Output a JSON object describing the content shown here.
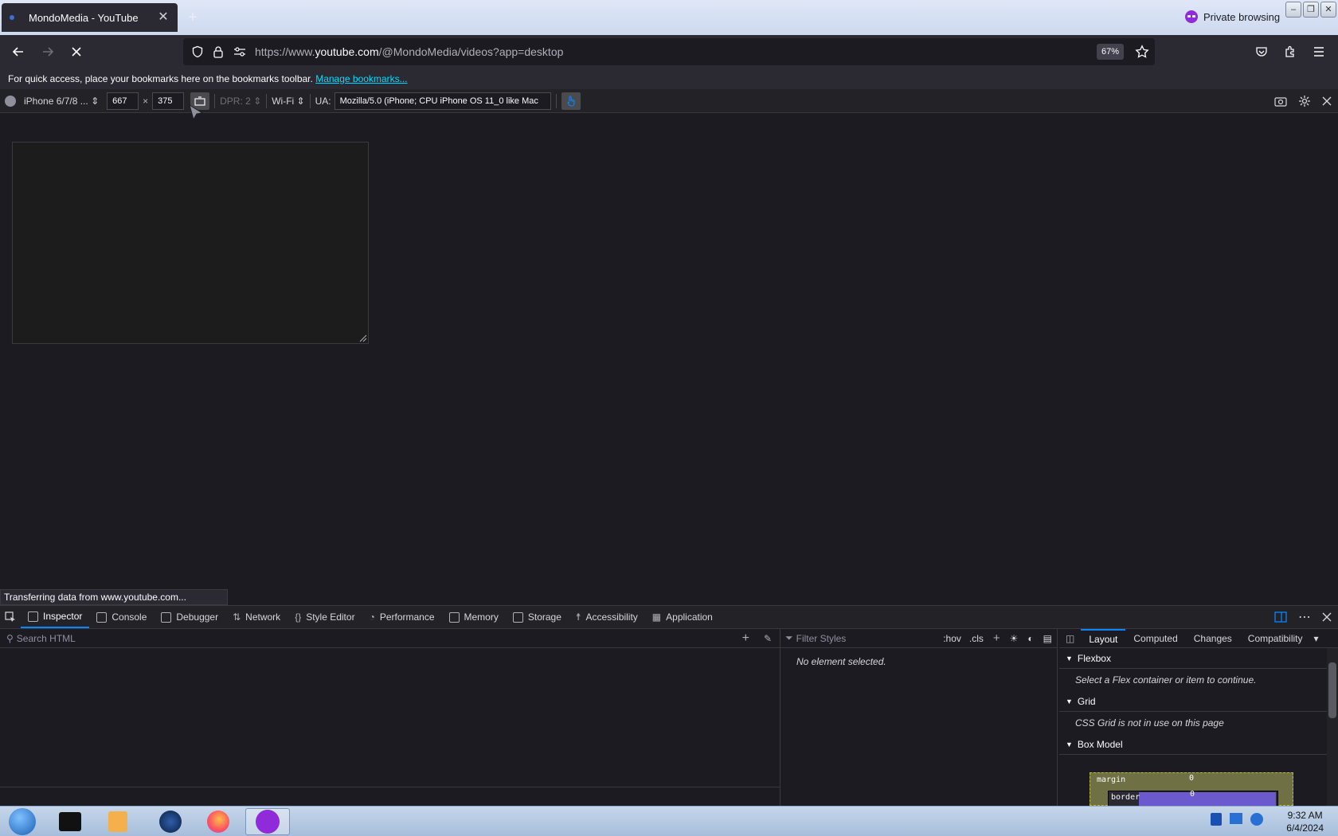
{
  "browser": {
    "tab_title": "MondoMedia - YouTube",
    "private_label": "Private browsing",
    "url_prefix": "https://www.",
    "url_domain": "youtube.com",
    "url_path": "/@MondoMedia/videos?app=desktop",
    "zoom": "67%",
    "bookmarks_text": "For quick access, place your bookmarks here on the bookmarks toolbar.",
    "bookmarks_link": "Manage bookmarks...",
    "status": "Transferring data from www.youtube.com..."
  },
  "rdm": {
    "device": "iPhone 6/7/8 ...",
    "width": "667",
    "times": "×",
    "height": "375",
    "dpr": "DPR: 2",
    "network": "Wi-Fi",
    "ua_label": "UA:",
    "ua_value": "Mozilla/5.0 (iPhone; CPU iPhone OS 11_0 like Mac"
  },
  "devtools": {
    "tabs": [
      "Inspector",
      "Console",
      "Debugger",
      "Network",
      "Style Editor",
      "Performance",
      "Memory",
      "Storage",
      "Accessibility",
      "Application"
    ],
    "search_placeholder": "Search HTML",
    "filter_placeholder": "Filter Styles",
    "hov": ":hov",
    "cls": ".cls",
    "no_element": "No element selected.",
    "layout_tabs": [
      "Layout",
      "Computed",
      "Changes",
      "Compatibility"
    ],
    "flexbox_title": "Flexbox",
    "flexbox_msg": "Select a Flex container or item to continue.",
    "grid_title": "Grid",
    "grid_msg": "CSS Grid is not in use on this page",
    "boxmodel_title": "Box Model",
    "box_margin": "margin",
    "box_border": "border",
    "box_margin_val": "0",
    "box_border_val": "0"
  },
  "taskbar": {
    "time": "9:32 AM",
    "date": "6/4/2024"
  },
  "colors": {
    "accent": "#0a84ff",
    "link": "#00ddff",
    "private": "#8f2bd8"
  }
}
